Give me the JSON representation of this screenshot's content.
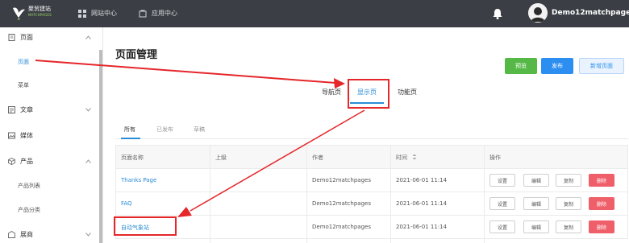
{
  "topbar": {
    "logo_text": "聚贸建站",
    "logo_sub": "MATCHPAGES",
    "nav": [
      {
        "label": "网站中心",
        "icon": "grid-icon"
      },
      {
        "label": "应用中心",
        "icon": "app-icon"
      }
    ],
    "username": "Demo12matchpages"
  },
  "sidebar": {
    "groups": [
      {
        "label": "页面",
        "icon": "page-icon"
      },
      {
        "label": "文章",
        "icon": "article-icon"
      },
      {
        "label": "媒体",
        "icon": "media-icon"
      },
      {
        "label": "产品",
        "icon": "product-icon"
      },
      {
        "label": "展商",
        "icon": "exhibitor-icon"
      }
    ],
    "subs": {
      "page": "页面",
      "menu": "菜单",
      "product_list": "产品列表",
      "product_category": "产品分类"
    }
  },
  "main": {
    "title": "页面管理",
    "buttons": {
      "preview": "预览",
      "publish": "发布",
      "new_page": "新增页面"
    },
    "tabs": [
      "导航页",
      "显示页",
      "功能页"
    ],
    "filters": [
      "所有",
      "已发布",
      "草稿"
    ],
    "table": {
      "headers": [
        "页面名称",
        "上级",
        "作者",
        "时间",
        "操作"
      ],
      "rows": [
        {
          "name": "Thanks Page",
          "parent": "",
          "author": "Demo12matchpages",
          "time": "2021-06-01 11:14"
        },
        {
          "name": "FAQ",
          "parent": "",
          "author": "Demo12matchpages",
          "time": "2021-06-01 11:14"
        },
        {
          "name": "自动气象站",
          "parent": "",
          "author": "Demo12matchpages",
          "time": "2021-06-01 11:14"
        }
      ],
      "actions": {
        "settings": "设置",
        "edit": "编辑",
        "copy": "复制",
        "delete": "删除"
      }
    }
  },
  "colors": {
    "topbar": "#3b3f45",
    "accent": "#2a8cd6",
    "green": "#56b947",
    "blue": "#2c8ef0",
    "danger": "#ef5f69",
    "annotation": "#e5262a"
  }
}
